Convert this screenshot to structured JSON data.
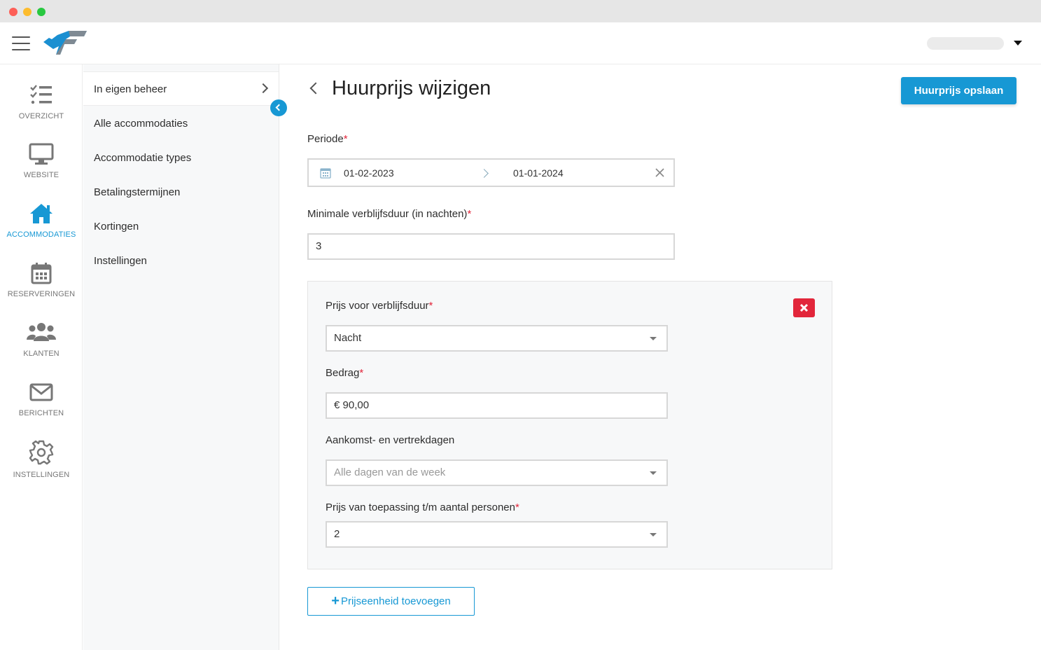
{
  "header": {
    "menu_icon": "hamburger-icon",
    "logo_icon": "eagle-logo-icon",
    "user_menu_icon": "caret-down-icon"
  },
  "sidebar": {
    "items": [
      {
        "label": "OVERZICHT",
        "icon": "checklist-icon"
      },
      {
        "label": "WEBSITE",
        "icon": "monitor-icon"
      },
      {
        "label": "ACCOMMODATIES",
        "icon": "home-icon",
        "active": true
      },
      {
        "label": "RESERVERINGEN",
        "icon": "calendar-icon"
      },
      {
        "label": "KLANTEN",
        "icon": "users-icon"
      },
      {
        "label": "BERICHTEN",
        "icon": "envelope-icon"
      },
      {
        "label": "INSTELLINGEN",
        "icon": "gear-icon"
      }
    ]
  },
  "subnav": {
    "items": [
      {
        "label": "In eigen beheer"
      },
      {
        "label": "Alle accommodaties"
      },
      {
        "label": "Accommodatie types"
      },
      {
        "label": "Betalingstermijnen"
      },
      {
        "label": "Kortingen"
      },
      {
        "label": "Instellingen"
      }
    ]
  },
  "main": {
    "title": "Huurprijs wijzigen",
    "save_label": "Huurprijs opslaan",
    "period": {
      "label": "Periode",
      "required_mark": "*",
      "from": "01-02-2023",
      "to": "01-01-2024"
    },
    "min_stay": {
      "label": "Minimale verblijfsduur (in nachten)",
      "required_mark": "*",
      "value": "3"
    },
    "price_unit": {
      "duration_label": "Prijs voor verblijfsduur",
      "duration_required": "*",
      "duration_value": "Nacht",
      "amount_label": "Bedrag",
      "amount_required": "*",
      "amount_value": "€ 90,00",
      "days_label": "Aankomst- en vertrekdagen",
      "days_placeholder": "Alle dagen van de week",
      "persons_label": "Prijs van toepassing t/m aantal personen",
      "persons_required": "*",
      "persons_value": "2"
    },
    "add_unit_label": "Prijseenheid toevoegen"
  },
  "colors": {
    "accent": "#1798d4",
    "danger": "#e2263b"
  }
}
